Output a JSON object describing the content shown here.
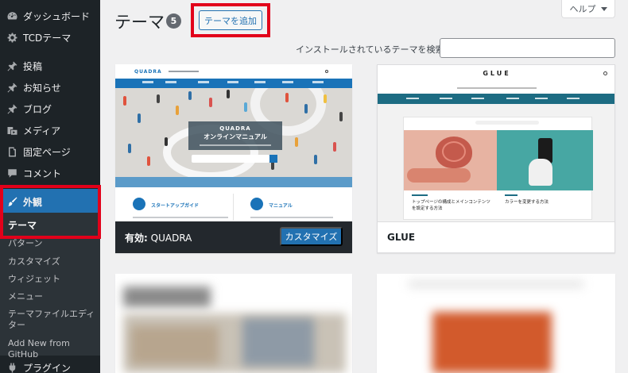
{
  "sidebar": {
    "items": [
      {
        "id": "dashboard",
        "label": "ダッシュボード",
        "icon": "dashboard-icon"
      },
      {
        "id": "tcd-theme",
        "label": "TCDテーマ",
        "icon": "gear-icon"
      },
      {
        "id": "posts",
        "label": "投稿",
        "icon": "pin-icon"
      },
      {
        "id": "news",
        "label": "お知らせ",
        "icon": "pin-icon"
      },
      {
        "id": "blog",
        "label": "ブログ",
        "icon": "pin-icon"
      },
      {
        "id": "media",
        "label": "メディア",
        "icon": "media-icon"
      },
      {
        "id": "pages",
        "label": "固定ページ",
        "icon": "page-icon"
      },
      {
        "id": "comments",
        "label": "コメント",
        "icon": "comment-icon"
      },
      {
        "id": "appearance",
        "label": "外観",
        "icon": "brush-icon"
      },
      {
        "id": "plugins",
        "label": "プラグイン",
        "icon": "plugin-icon"
      }
    ],
    "submenu": [
      {
        "id": "themes",
        "label": "テーマ"
      },
      {
        "id": "patterns",
        "label": "パターン"
      },
      {
        "id": "customize",
        "label": "カスタマイズ"
      },
      {
        "id": "widgets",
        "label": "ウィジェット"
      },
      {
        "id": "menus",
        "label": "メニュー"
      },
      {
        "id": "theme-file-editor",
        "label": "テーマファイルエディター"
      },
      {
        "id": "add-new-github",
        "label": "Add New from GitHub"
      }
    ]
  },
  "header": {
    "title": "テーマ",
    "count": "5",
    "add_button": "テーマを追加",
    "help": "ヘルプ"
  },
  "search": {
    "label": "インストールされているテーマを検索",
    "value": ""
  },
  "themes": {
    "quadra": {
      "logo": "QUADRA",
      "hero_title_en": "QUADRA",
      "hero_title_jp": "オンラインマニュアル",
      "section_left": "スタートアップガイド",
      "section_right": "マニュアル",
      "active_prefix": "有効:",
      "name": "QUADRA",
      "customize_button": "カスタマイズ"
    },
    "glue": {
      "logo": "GLUE",
      "article_left": "トップページの構成とメインコンテンツを設定する方法",
      "article_right": "カラーを変更する方法",
      "name": "GLUE"
    }
  },
  "colors": {
    "sidebar_bg": "#1d2327",
    "submenu_bg": "#2c3338",
    "accent": "#2271b1",
    "highlight_box": "#e2001a"
  }
}
